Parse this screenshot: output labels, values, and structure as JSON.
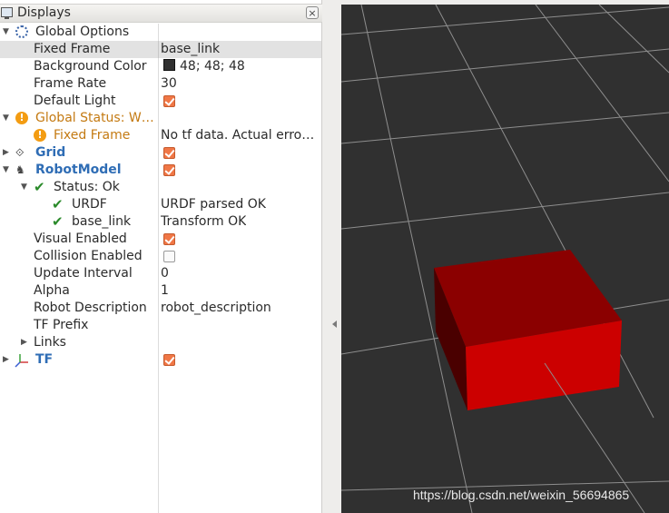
{
  "panel": {
    "title": "Displays",
    "close_symbol": "×"
  },
  "tree": {
    "global_options": {
      "label": "Global Options",
      "fixed_frame": {
        "label": "Fixed Frame",
        "value": "base_link"
      },
      "background_color": {
        "label": "Background Color",
        "value": "48; 48; 48",
        "swatch": "#303030"
      },
      "frame_rate": {
        "label": "Frame Rate",
        "value": "30"
      },
      "default_light": {
        "label": "Default Light",
        "checked": true
      }
    },
    "global_status": {
      "label": "Global Status: W…",
      "fixed_frame": {
        "label": "Fixed Frame",
        "value": "No tf data.  Actual erro…"
      }
    },
    "grid": {
      "label": "Grid",
      "checked": true
    },
    "robot_model": {
      "label": "RobotModel",
      "checked": true,
      "status": {
        "label": "Status: Ok"
      },
      "urdf": {
        "label": "URDF",
        "value": "URDF parsed OK"
      },
      "base_link": {
        "label": "base_link",
        "value": "Transform OK"
      },
      "visual_enabled": {
        "label": "Visual Enabled",
        "checked": true
      },
      "collision_enabled": {
        "label": "Collision Enabled",
        "checked": false
      },
      "update_interval": {
        "label": "Update Interval",
        "value": "0"
      },
      "alpha": {
        "label": "Alpha",
        "value": "1"
      },
      "robot_description": {
        "label": "Robot Description",
        "value": "robot_description"
      },
      "tf_prefix": {
        "label": "TF Prefix",
        "value": ""
      },
      "links": {
        "label": "Links"
      }
    },
    "tf": {
      "label": "TF",
      "checked": true
    }
  },
  "colors": {
    "accent_orange": "#f07746",
    "warning": "#c47a12",
    "display_blue": "#2f6db5",
    "ok_green": "#2a8a2a",
    "view_background": "#303030",
    "box_red": "#cc0000"
  },
  "watermark": "https://blog.csdn.net/weixin_56694865"
}
